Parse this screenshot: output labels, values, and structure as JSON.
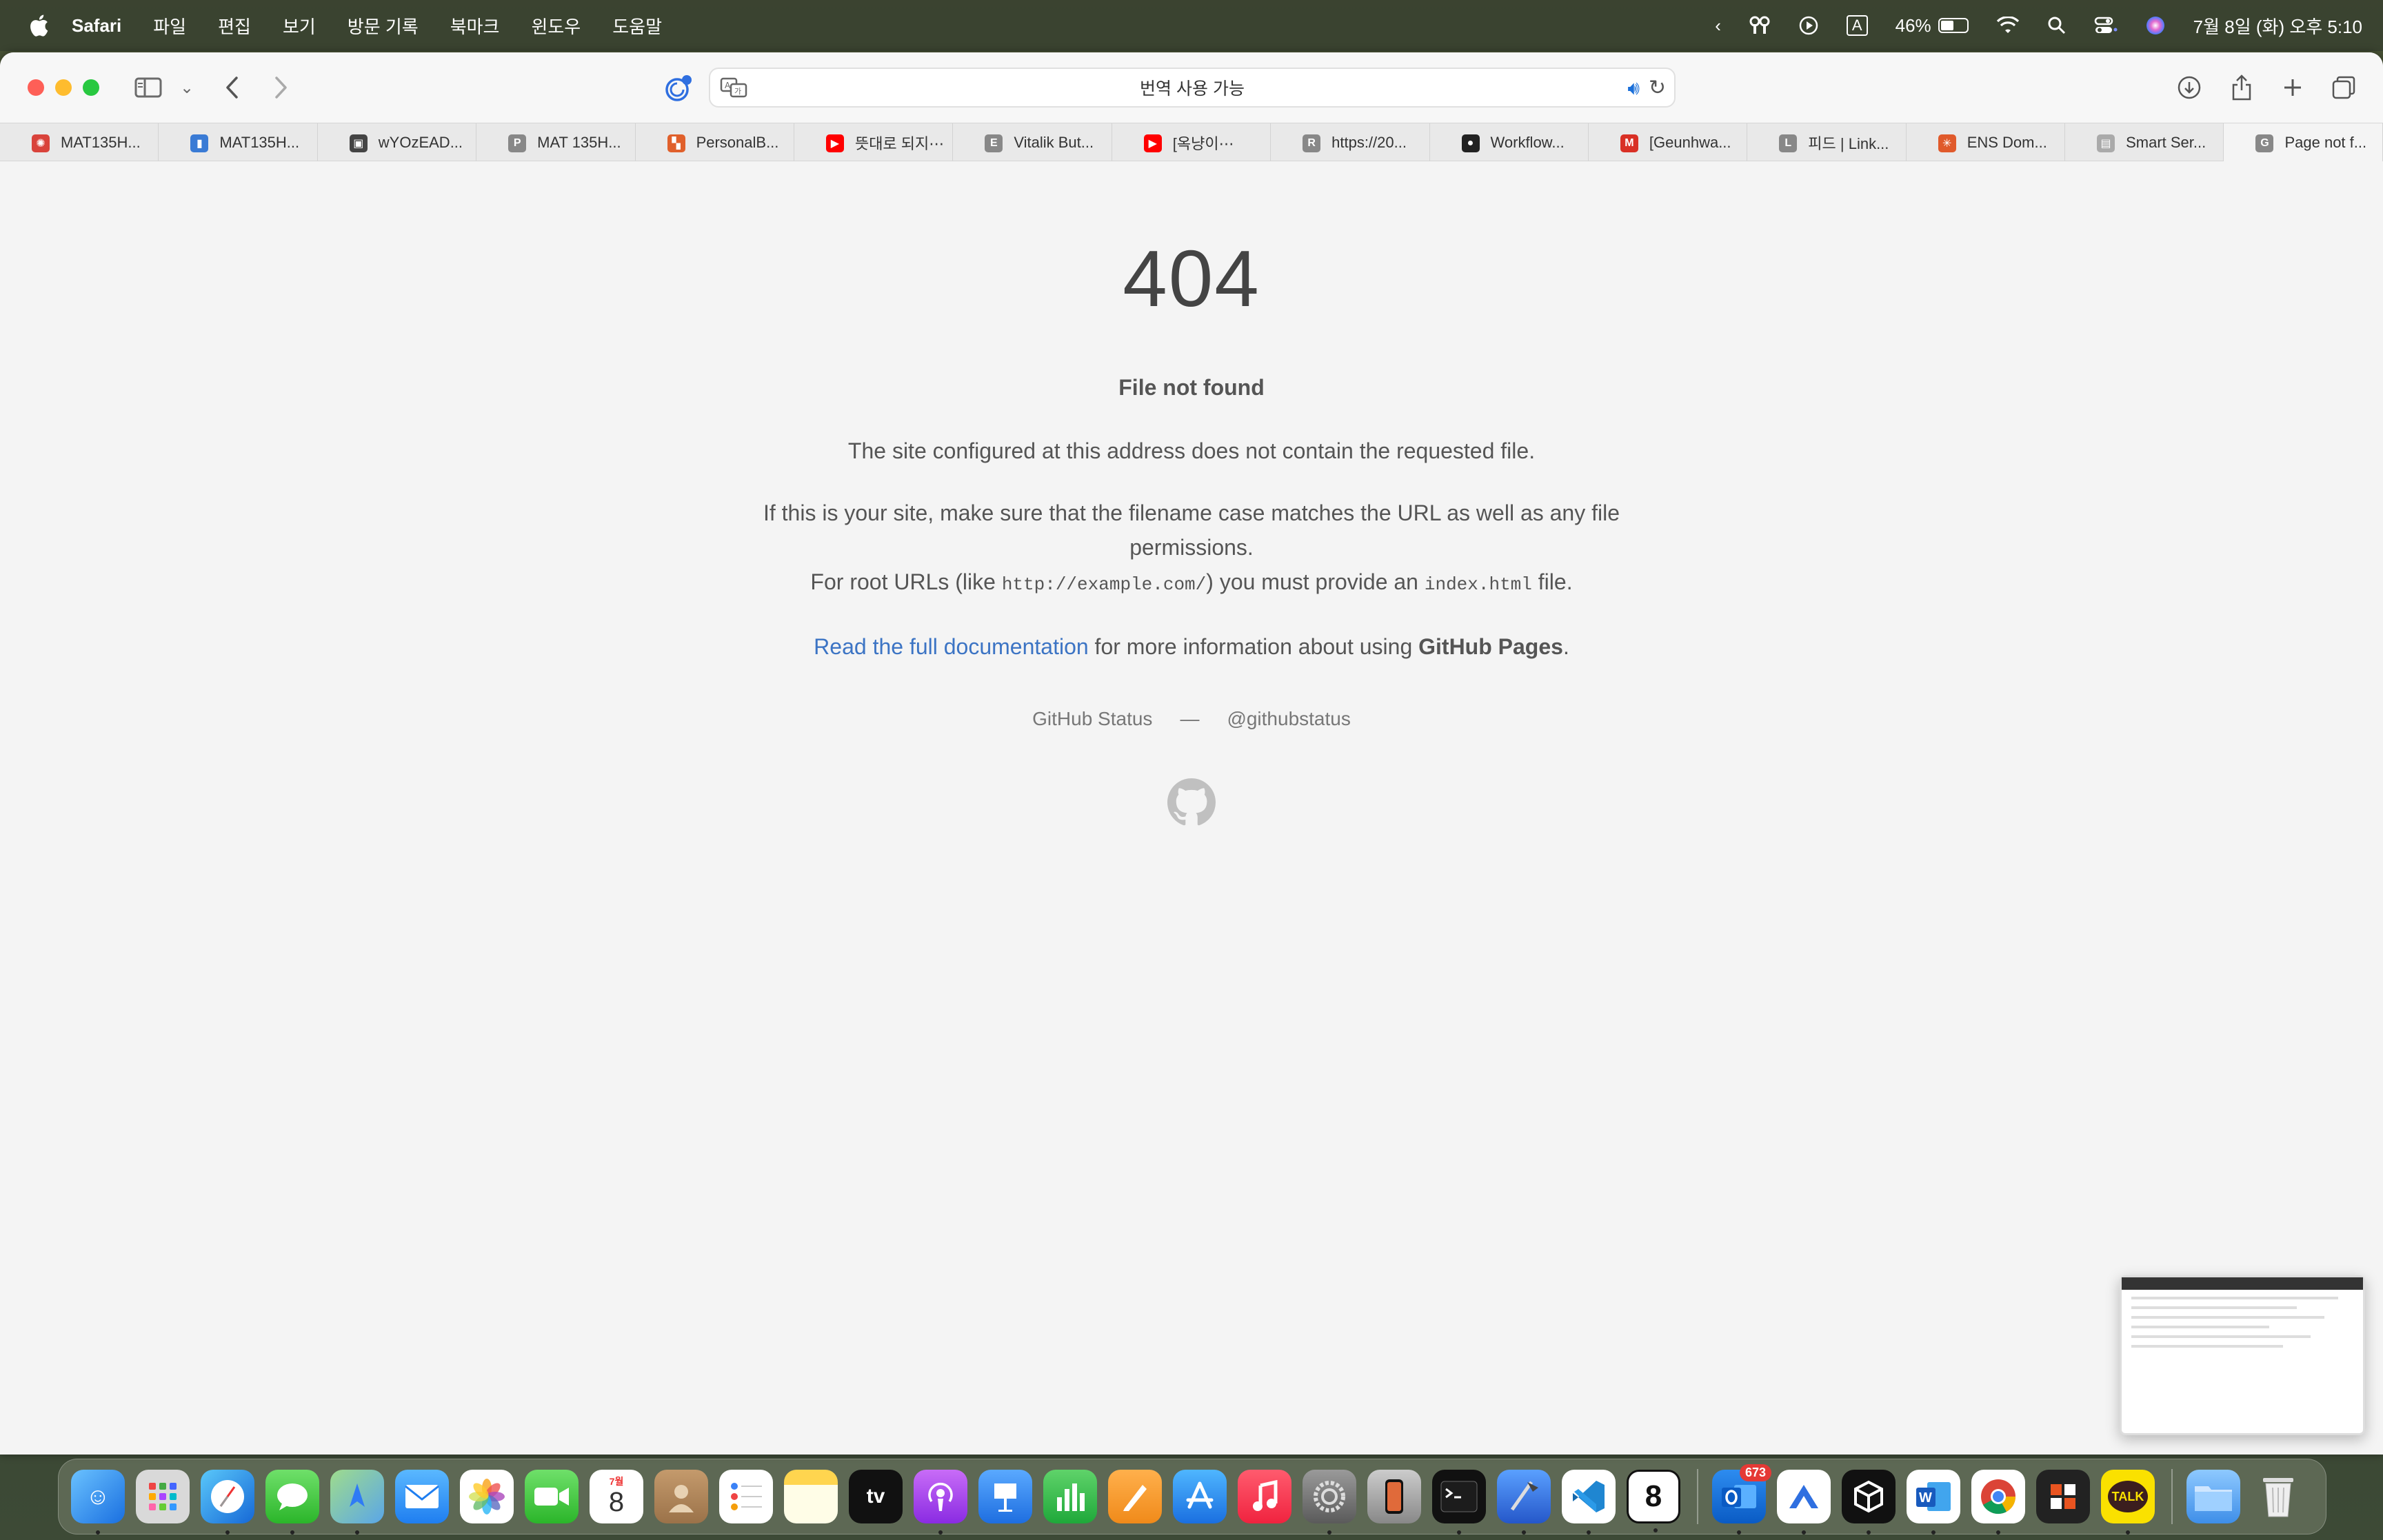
{
  "menubar": {
    "app": "Safari",
    "items": [
      "파일",
      "편집",
      "보기",
      "방문 기록",
      "북마크",
      "윈도우",
      "도움말"
    ],
    "battery": "46%",
    "input_indicator": "A",
    "datetime": "7월 8일 (화) 오후 5:10"
  },
  "toolbar": {
    "url_text": "번역 사용 가능"
  },
  "tabs": [
    {
      "label": "MAT135H...",
      "color": "#d9433b",
      "glyph": "✺"
    },
    {
      "label": "MAT135H...",
      "color": "#3a7bd5",
      "glyph": "▮"
    },
    {
      "label": "wYOzEAD...",
      "color": "#444444",
      "glyph": "▣"
    },
    {
      "label": "MAT 135H...",
      "color": "#888888",
      "glyph": "P"
    },
    {
      "label": "PersonalB...",
      "color": "#e0602b",
      "glyph": "▚"
    },
    {
      "label": "뜻대로 되지⋯",
      "color": "#ff0000",
      "glyph": "▶"
    },
    {
      "label": "Vitalik But...",
      "color": "#888888",
      "glyph": "E"
    },
    {
      "label": "[옥냥이⋯",
      "color": "#ff0000",
      "glyph": "▶"
    },
    {
      "label": "https://20...",
      "color": "#888888",
      "glyph": "R"
    },
    {
      "label": "Workflow...",
      "color": "#222222",
      "glyph": "●"
    },
    {
      "label": "[Geunhwa...",
      "color": "#d93025",
      "glyph": "M"
    },
    {
      "label": "피드 | Link...",
      "color": "#888888",
      "glyph": "L"
    },
    {
      "label": "ENS Dom...",
      "color": "#e05a2b",
      "glyph": "✳"
    },
    {
      "label": "Smart Ser...",
      "color": "#aaaaaa",
      "glyph": "▤"
    },
    {
      "label": "Page not f...",
      "color": "#888888",
      "glyph": "G"
    }
  ],
  "page": {
    "code": "404",
    "subtitle": "File not found",
    "p1": "The site configured at this address does not contain the requested file.",
    "p2_a": "If this is your site, make sure that the filename case matches the URL as well as any file permissions.",
    "p2_b_prefix": "For root URLs (like ",
    "p2_b_code1": "http://example.com/",
    "p2_b_mid": ") you must provide an ",
    "p2_b_code2": "index.html",
    "p2_b_suffix": " file.",
    "p3_link": "Read the full documentation",
    "p3_mid": " for more information about using ",
    "p3_strong": "GitHub Pages",
    "p3_end": ".",
    "footer_status": "GitHub Status",
    "footer_sep": "—",
    "footer_twitter": "@githubstatus"
  },
  "dock": {
    "outlook_badge": "673",
    "calendar_month": "7월",
    "calendar_day": "8",
    "tv_label": "tv",
    "kakao_label": "TALK"
  }
}
